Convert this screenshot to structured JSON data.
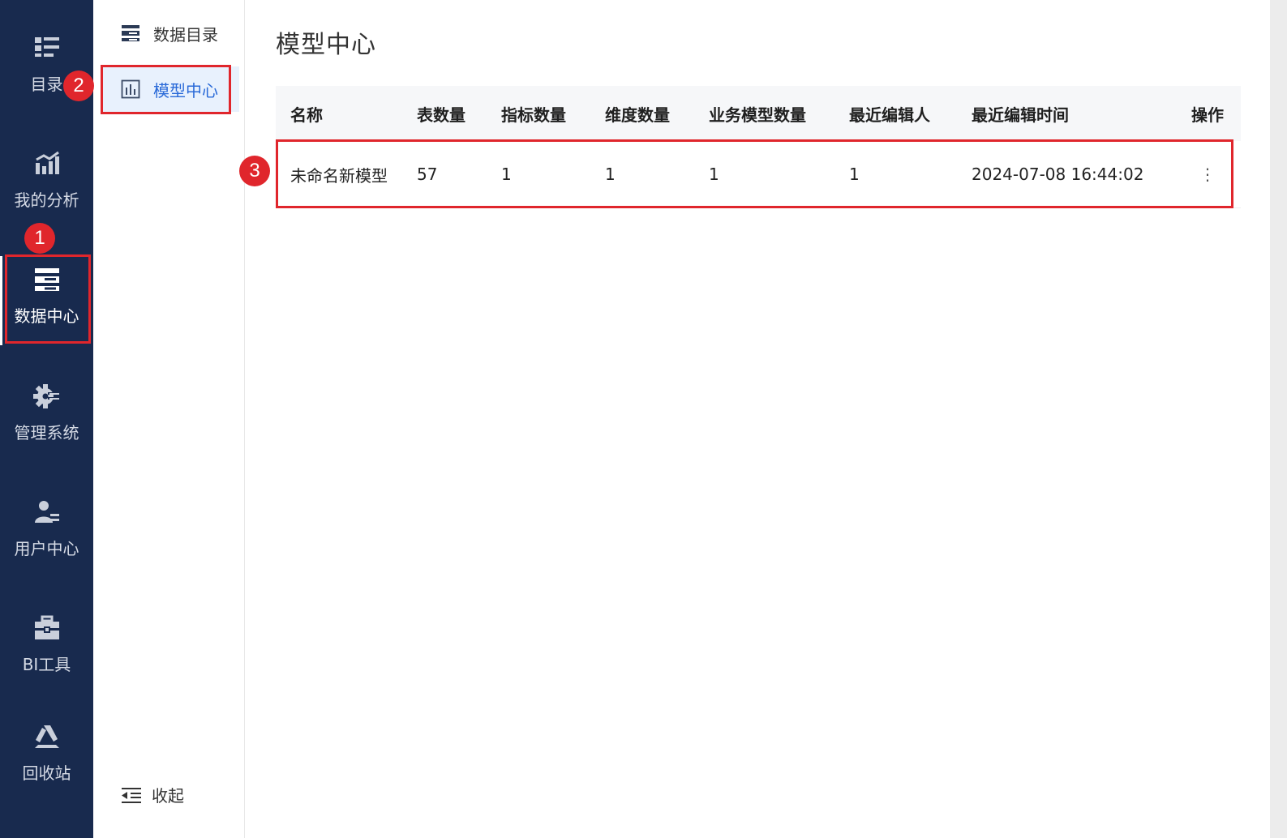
{
  "rail": {
    "items": [
      {
        "label": "目录",
        "icon": "catalog-icon"
      },
      {
        "label": "我的分析",
        "icon": "analysis-icon"
      },
      {
        "label": "数据中心",
        "icon": "data-center-icon"
      },
      {
        "label": "管理系统",
        "icon": "gear-icon"
      },
      {
        "label": "用户中心",
        "icon": "user-icon"
      },
      {
        "label": "BI工具",
        "icon": "toolbox-icon"
      },
      {
        "label": "回收站",
        "icon": "recycle-icon"
      }
    ],
    "active_index": 2
  },
  "subnav": {
    "items": [
      {
        "label": "数据目录",
        "icon": "data-catalog-icon"
      },
      {
        "label": "模型中心",
        "icon": "bar-chart-icon"
      }
    ],
    "active_index": 1,
    "collapse_label": "收起"
  },
  "main": {
    "title": "模型中心",
    "table": {
      "headers": [
        "名称",
        "表数量",
        "指标数量",
        "维度数量",
        "业务模型数量",
        "最近编辑人",
        "最近编辑时间",
        "操作"
      ],
      "rows": [
        [
          "未命名新模型",
          "57",
          "1",
          "1",
          "1",
          "1",
          "2024-07-08 16:44:02",
          "⋮"
        ]
      ]
    }
  },
  "annotations": {
    "badges": [
      "1",
      "2",
      "3"
    ],
    "color": "#e0262c"
  },
  "colors": {
    "rail_bg": "#182a4e",
    "accent": "#2a6ad8",
    "active_bg": "#e8f1fd"
  }
}
